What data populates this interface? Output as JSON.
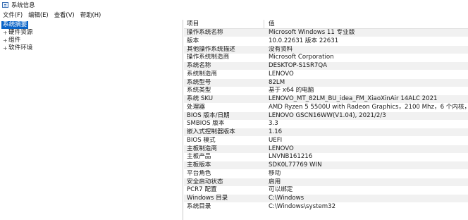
{
  "window": {
    "title": "系统信息"
  },
  "menu": [
    "文件(F)",
    "编辑(E)",
    "查看(V)",
    "帮助(H)"
  ],
  "tree": {
    "root": "系统摘要",
    "children": [
      {
        "label": "硬件资源",
        "expander": "+"
      },
      {
        "label": "组件",
        "expander": "+"
      },
      {
        "label": "软件环境",
        "expander": "+"
      }
    ]
  },
  "table": {
    "headers": [
      "项目",
      "值"
    ],
    "rows": [
      [
        "操作系统名称",
        "Microsoft Windows 11 专业版"
      ],
      [
        "版本",
        "10.0.22631 版本 22631"
      ],
      [
        "其他操作系统描述",
        "没有资料"
      ],
      [
        "操作系统制造商",
        "Microsoft Corporation"
      ],
      [
        "系统名称",
        "DESKTOP-S1SR7QA"
      ],
      [
        "系统制造商",
        "LENOVO"
      ],
      [
        "系统型号",
        "82LM"
      ],
      [
        "系统类型",
        "基于 x64 的电脑"
      ],
      [
        "系统 SKU",
        "LENOVO_MT_82LM_BU_idea_FM_XiaoXinAir 14ALC 2021"
      ],
      [
        "处理器",
        "AMD Ryzen 5 5500U with Radeon Graphics，2100 Mhz，6 个内核，12..."
      ],
      [
        "BIOS 版本/日期",
        "LENOVO GSCN16WW(V1.04), 2021/2/3"
      ],
      [
        "SMBIOS 版本",
        "3.3"
      ],
      [
        "嵌入式控制器版本",
        "1.16"
      ],
      [
        "BIOS 模式",
        "UEFI"
      ],
      [
        "主板制造商",
        "LENOVO"
      ],
      [
        "主板产品",
        "LNVNB161216"
      ],
      [
        "主板版本",
        "SDK0L77769 WIN"
      ],
      [
        "平台角色",
        "移动"
      ],
      [
        "安全启动状态",
        "启用"
      ],
      [
        "PCR7 配置",
        "可以绑定"
      ],
      [
        "Windows 目录",
        "C:\\Windows"
      ],
      [
        "系统目录",
        "C:\\Windows\\system32"
      ]
    ]
  }
}
